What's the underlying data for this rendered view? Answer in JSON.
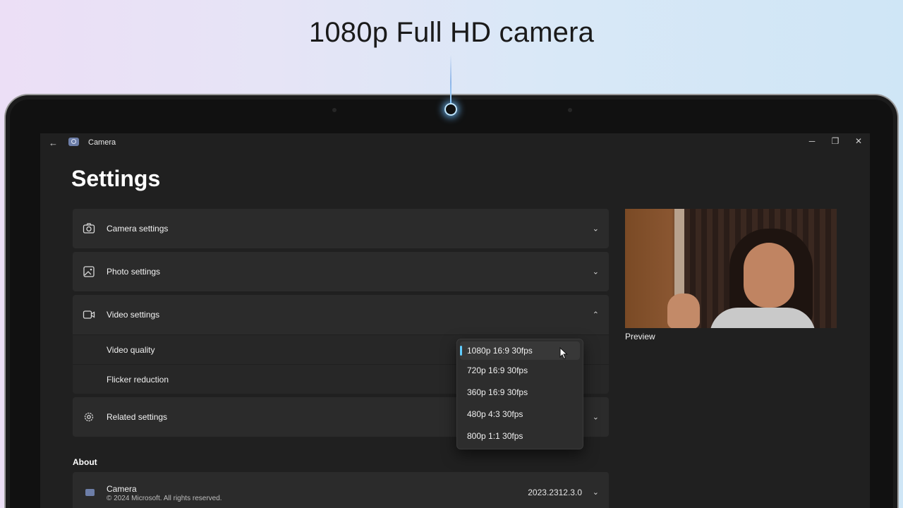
{
  "headline": "1080p Full HD camera",
  "window": {
    "back_glyph": "←",
    "app_icon": "camera-app-icon",
    "title": "Camera",
    "minimize_glyph": "─",
    "restore_glyph": "❐",
    "close_glyph": "✕"
  },
  "page_title": "Settings",
  "sections": [
    {
      "label": "Camera settings",
      "icon": "camera-icon",
      "expanded": false
    },
    {
      "label": "Photo settings",
      "icon": "photo-icon",
      "expanded": false
    },
    {
      "label": "Video settings",
      "icon": "video-icon",
      "expanded": true
    },
    {
      "label": "Related settings",
      "icon": "gear-icon",
      "expanded": false
    }
  ],
  "video_settings": {
    "video_quality_label": "Video quality",
    "flicker_reduction_label": "Flicker reduction"
  },
  "video_quality_options": [
    {
      "label": "1080p 16:9 30fps",
      "selected": true
    },
    {
      "label": "720p 16:9 30fps",
      "selected": false
    },
    {
      "label": "360p 16:9 30fps",
      "selected": false
    },
    {
      "label": "480p 4:3 30fps",
      "selected": false
    },
    {
      "label": "800p 1:1 30fps",
      "selected": false
    }
  ],
  "about": {
    "heading": "About",
    "app_name": "Camera",
    "copyright": "© 2024 Microsoft. All rights reserved.",
    "version": "2023.2312.3.0"
  },
  "preview": {
    "label": "Preview"
  },
  "chevrons": {
    "down": "⌄",
    "up": "⌃"
  },
  "colors": {
    "accent": "#60cdff",
    "background": "#202020",
    "card": "#2b2b2b"
  }
}
